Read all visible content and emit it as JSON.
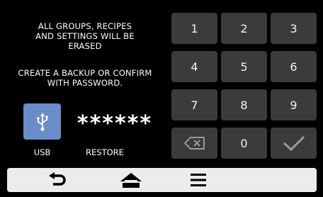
{
  "message": {
    "warning_lines": [
      "ALL GROUPS, RECIPES",
      "AND SETTINGS WILL BE",
      "ERASED"
    ],
    "confirm_lines": [
      "CREATE A BACKUP  OR CONFIRM",
      "WITH PASSWORD."
    ]
  },
  "usb": {
    "label": "USB",
    "icon": "usb-icon"
  },
  "password": {
    "masked_value": "******"
  },
  "restore": {
    "label": "RESTORE"
  },
  "keypad": {
    "keys": [
      "1",
      "2",
      "3",
      "4",
      "5",
      "6",
      "7",
      "8",
      "9"
    ],
    "zero": "0",
    "backspace_icon": "backspace-icon",
    "confirm_icon": "checkmark-icon"
  },
  "nav": {
    "back_icon": "back-arrow-icon",
    "home_icon": "home-icon",
    "menu_icon": "menu-icon"
  },
  "colors": {
    "background": "#000000",
    "key": "#3b3b3b",
    "usb_button": "#6b8dc9",
    "nav_bar": "#ececec"
  }
}
